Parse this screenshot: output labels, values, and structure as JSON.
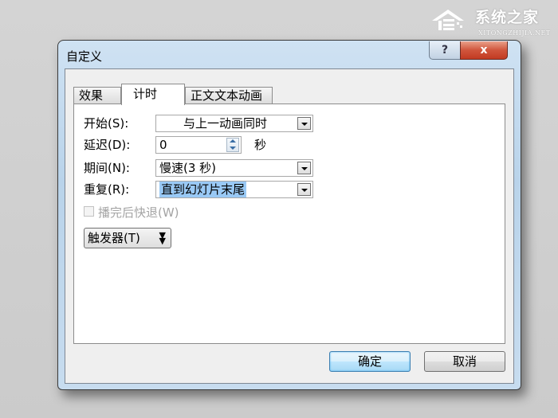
{
  "watermark": {
    "brand": "系统之家",
    "site": "XITONGZHIJIA.NET"
  },
  "dialog": {
    "title": "自定义",
    "help_label": "?",
    "close_label": "x",
    "tabs": [
      {
        "label": "效果",
        "active": false
      },
      {
        "label": "计时",
        "active": true
      },
      {
        "label": "正文文本动画",
        "active": false
      }
    ],
    "fields": {
      "start": {
        "label": "开始(S):",
        "value": "与上一动画同时"
      },
      "delay": {
        "label": "延迟(D):",
        "value": "0",
        "unit": "秒"
      },
      "duration": {
        "label": "期间(N):",
        "value": "慢速(3 秒)"
      },
      "repeat": {
        "label": "重复(R):",
        "value": "直到幻灯片末尾"
      }
    },
    "rewind": {
      "label": "播完后快退(W)",
      "checked": false,
      "enabled": false
    },
    "trigger_label": "触发器(T)",
    "ok_label": "确定",
    "cancel_label": "取消"
  }
}
